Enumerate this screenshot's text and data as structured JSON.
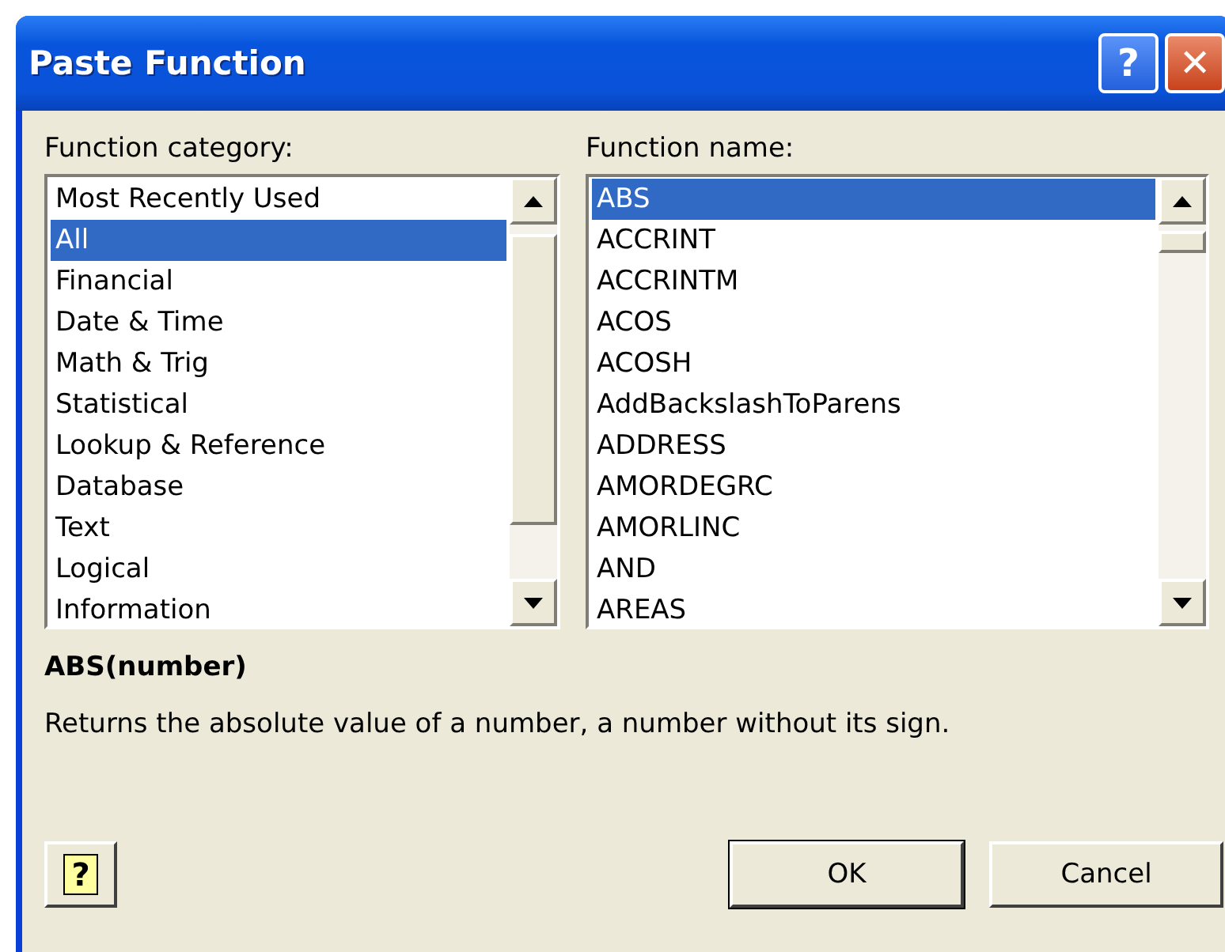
{
  "window": {
    "title": "Paste Function"
  },
  "title_buttons": [
    {
      "kind": "help",
      "label": "?"
    },
    {
      "kind": "close",
      "label": "✕"
    }
  ],
  "category_list": {
    "label": "Function category:",
    "items": [
      {
        "label": "Most Recently Used",
        "selected": false
      },
      {
        "label": "All",
        "selected": true
      },
      {
        "label": "Financial",
        "selected": false
      },
      {
        "label": "Date & Time",
        "selected": false
      },
      {
        "label": "Math & Trig",
        "selected": false
      },
      {
        "label": "Statistical",
        "selected": false
      },
      {
        "label": "Lookup & Reference",
        "selected": false
      },
      {
        "label": "Database",
        "selected": false
      },
      {
        "label": "Text",
        "selected": false
      },
      {
        "label": "Logical",
        "selected": false
      },
      {
        "label": "Information",
        "selected": false
      }
    ]
  },
  "function_list": {
    "label": "Function name:",
    "items": [
      {
        "label": "ABS",
        "selected": true
      },
      {
        "label": "ACCRINT",
        "selected": false
      },
      {
        "label": "ACCRINTM",
        "selected": false
      },
      {
        "label": "ACOS",
        "selected": false
      },
      {
        "label": "ACOSH",
        "selected": false
      },
      {
        "label": "AddBackslashToParens",
        "selected": false
      },
      {
        "label": "ADDRESS",
        "selected": false
      },
      {
        "label": "AMORDEGRC",
        "selected": false
      },
      {
        "label": "AMORLINC",
        "selected": false
      },
      {
        "label": "AND",
        "selected": false
      },
      {
        "label": "AREAS",
        "selected": false
      }
    ]
  },
  "syntax": "ABS(number)",
  "description": "Returns the absolute value of a number, a number without its sign.",
  "buttons": [
    {
      "kind": "help",
      "label": "?"
    },
    {
      "kind": "ok",
      "label": "OK"
    },
    {
      "kind": "cancel",
      "label": "Cancel"
    }
  ]
}
